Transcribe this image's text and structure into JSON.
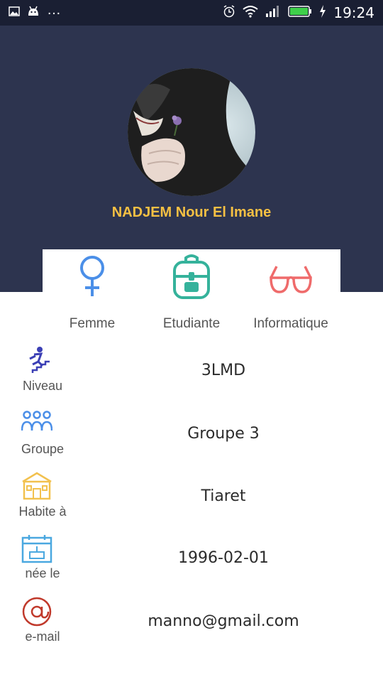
{
  "status_bar": {
    "time": "19:24",
    "left_icons": [
      "image-icon",
      "android-icon",
      "more-dots-icon"
    ],
    "right_icons": [
      "alarm-icon",
      "wifi-icon",
      "signal-icon",
      "battery-icon",
      "charging-icon"
    ],
    "overflow_dots": "…"
  },
  "profile": {
    "name": "NADJEM Nour El Imane"
  },
  "cards": [
    {
      "icon": "female-symbol-icon",
      "label": "Femme"
    },
    {
      "icon": "backpack-icon",
      "label": "Etudiante"
    },
    {
      "icon": "glasses-icon",
      "label": "Informatique"
    }
  ],
  "info": [
    {
      "icon": "stairs-runner-icon",
      "label": "Niveau",
      "value": "3LMD"
    },
    {
      "icon": "group-icon",
      "label": "Groupe",
      "value": "Groupe 3"
    },
    {
      "icon": "house-icon",
      "label": "Habite à",
      "value": "Tiaret"
    },
    {
      "icon": "calendar-icon",
      "label": "née le",
      "value": "1996-02-01"
    },
    {
      "icon": "at-sign-icon",
      "label": "e-mail",
      "value": "manno@gmail.com"
    }
  ],
  "colors": {
    "status_bar": "#1a1f33",
    "header": "#2d344f",
    "name": "#f5c043",
    "female_icon": "#4b8fe8",
    "backpack_icon": "#35b29b",
    "glasses_icon": "#ef6b6b"
  }
}
